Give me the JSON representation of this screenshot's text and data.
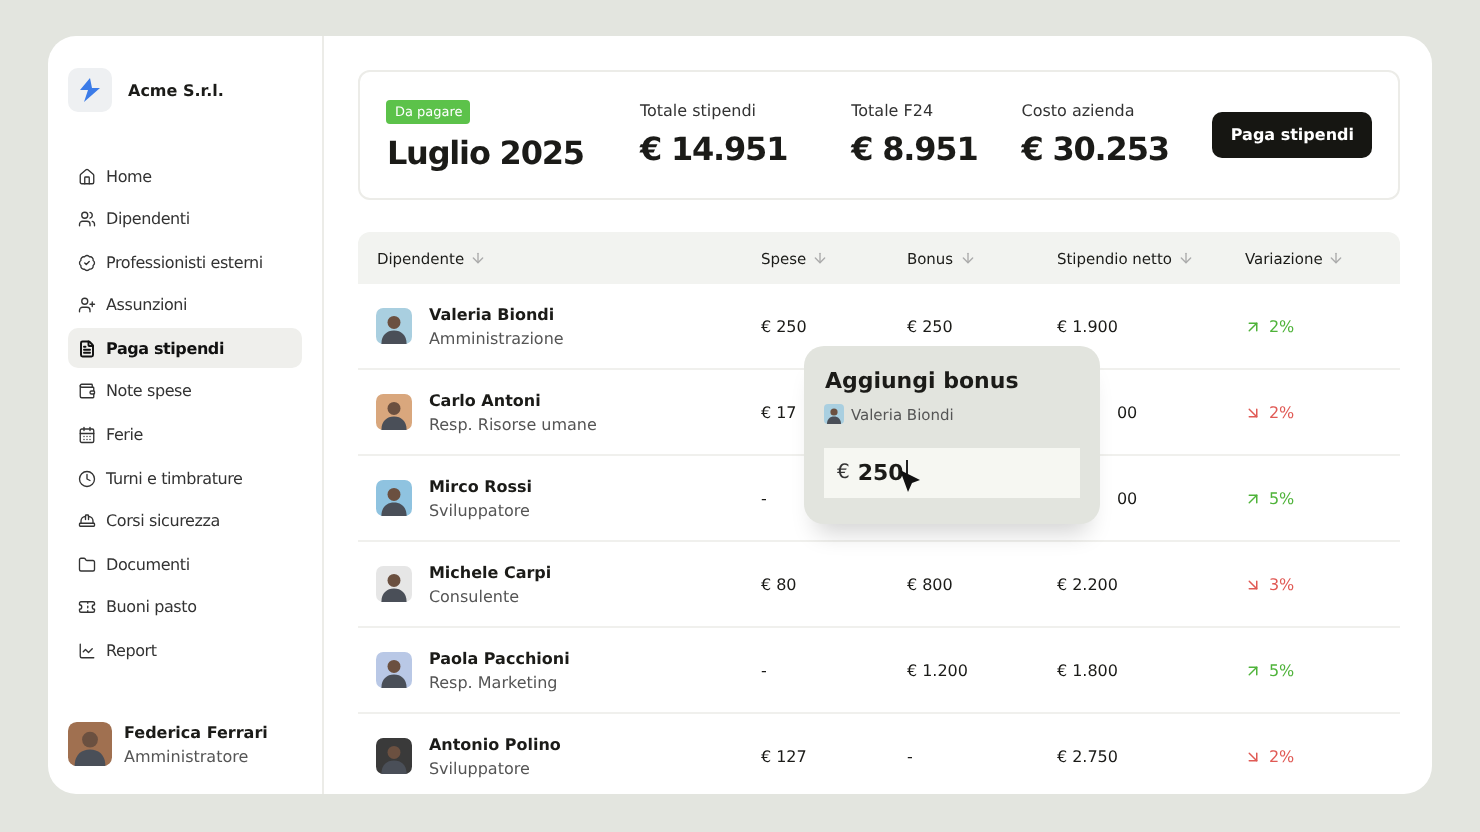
{
  "company": {
    "name": "Acme S.r.l."
  },
  "nav": [
    {
      "label": "Home",
      "selected": false
    },
    {
      "label": "Dipendenti",
      "selected": false
    },
    {
      "label": "Professionisti esterni",
      "selected": false
    },
    {
      "label": "Assunzioni",
      "selected": false
    },
    {
      "label": "Paga stipendi",
      "selected": true
    },
    {
      "label": "Note spese",
      "selected": false
    },
    {
      "label": "Ferie",
      "selected": false
    },
    {
      "label": "Turni e timbrature",
      "selected": false
    },
    {
      "label": "Corsi sicurezza",
      "selected": false
    },
    {
      "label": "Documenti",
      "selected": false
    },
    {
      "label": "Buoni pasto",
      "selected": false
    },
    {
      "label": "Report",
      "selected": false
    }
  ],
  "user": {
    "name": "Federica Ferrari",
    "role": "Amministratore"
  },
  "summary": {
    "badge": "Da pagare",
    "period": "Luglio 2025",
    "stats": [
      {
        "label": "Totale stipendi",
        "value": "€ 14.951"
      },
      {
        "label": "Totale F24",
        "value": "€ 8.951"
      },
      {
        "label": "Costo azienda",
        "value": "€ 30.253"
      }
    ],
    "button": "Paga stipendi"
  },
  "table": {
    "columns": [
      "Dipendente",
      "Spese",
      "Bonus",
      "Stipendio netto",
      "Variazione"
    ],
    "rows": [
      {
        "name": "Valeria Biondi",
        "role": "Amministrazione",
        "spese": "€ 250",
        "bonus": "€ 250",
        "stipendio": "€ 1.900",
        "kind": "up",
        "variazione": "2%"
      },
      {
        "name": "Carlo Antoni",
        "role": "Resp. Risorse umane",
        "spese": "€ 17",
        "stipendio": "00",
        "kind": "down",
        "variazione": "2%"
      },
      {
        "name": "Mirco Rossi",
        "role": "Sviluppatore",
        "spese": "-",
        "stipendio": "00",
        "kind": "up",
        "variazione": "5%"
      },
      {
        "name": "Michele Carpi",
        "role": "Consulente",
        "spese": "€ 80",
        "bonus": "€ 800",
        "stipendio": "€ 2.200",
        "kind": "down",
        "variazione": "3%"
      },
      {
        "name": "Paola Pacchioni",
        "role": "Resp. Marketing",
        "spese": "-",
        "bonus": "€ 1.200",
        "stipendio": "€ 1.800",
        "kind": "up",
        "variazione": "5%"
      },
      {
        "name": "Antonio Polino",
        "role": "Sviluppatore",
        "spese": "€ 127",
        "bonus": "-",
        "stipendio": "€ 2.750",
        "kind": "down",
        "variazione": "2%"
      }
    ]
  },
  "popover": {
    "title": "Aggiungi bonus",
    "person": "Valeria Biondi",
    "currency": "€",
    "value": "250"
  }
}
